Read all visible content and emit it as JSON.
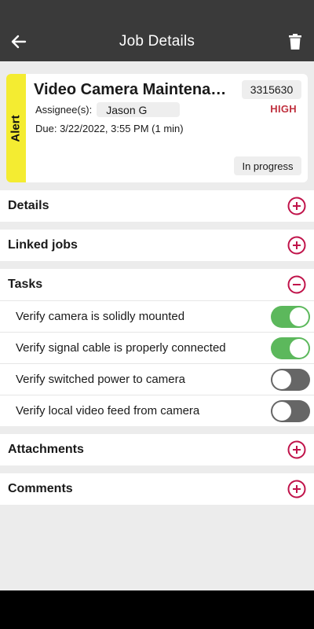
{
  "app_bar": {
    "title": "Job Details",
    "back_icon": "arrow-left-icon",
    "delete_icon": "trash-icon"
  },
  "job": {
    "alert_label": "Alert",
    "title": "Video Camera Maintenance",
    "id": "3315630",
    "assignee_label": "Assignee(s):",
    "assignee": "Jason G",
    "priority": "HIGH",
    "due": "Due: 3/22/2022, 3:55 PM (1 min)",
    "status": "In progress"
  },
  "sections": {
    "details": "Details",
    "linked_jobs": "Linked jobs",
    "tasks": "Tasks",
    "attachments": "Attachments",
    "comments": "Comments"
  },
  "tasks": [
    {
      "label": "Verify camera is solidly mounted",
      "checked": true
    },
    {
      "label": "Verify signal cable is properly connected",
      "checked": true
    },
    {
      "label": "Verify switched power to camera",
      "checked": false
    },
    {
      "label": "Verify local video feed from camera",
      "checked": false
    }
  ],
  "colors": {
    "accent": "#c0134a",
    "alert": "#f4ec31",
    "toggle_on": "#5cb85c",
    "toggle_off": "#666666",
    "priority": "#c0313f"
  }
}
